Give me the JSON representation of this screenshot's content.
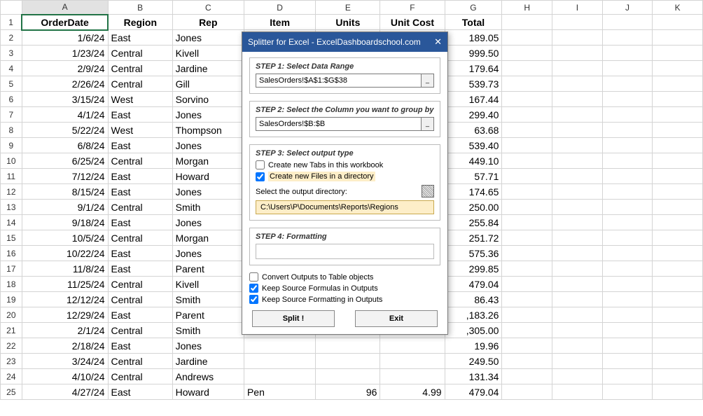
{
  "columns": [
    "",
    "A",
    "B",
    "C",
    "D",
    "E",
    "F",
    "G",
    "H",
    "I",
    "J",
    "K"
  ],
  "headers": [
    "OrderDate",
    "Region",
    "Rep",
    "Item",
    "Units",
    "Unit Cost",
    "Total"
  ],
  "rows": [
    {
      "n": 2,
      "d": "1/6/24",
      "reg": "East",
      "rep": "Jones",
      "t": "189.05"
    },
    {
      "n": 3,
      "d": "1/23/24",
      "reg": "Central",
      "rep": "Kivell",
      "t": "999.50"
    },
    {
      "n": 4,
      "d": "2/9/24",
      "reg": "Central",
      "rep": "Jardine",
      "t": "179.64"
    },
    {
      "n": 5,
      "d": "2/26/24",
      "reg": "Central",
      "rep": "Gill",
      "t": "539.73"
    },
    {
      "n": 6,
      "d": "3/15/24",
      "reg": "West",
      "rep": "Sorvino",
      "t": "167.44"
    },
    {
      "n": 7,
      "d": "4/1/24",
      "reg": "East",
      "rep": "Jones",
      "t": "299.40"
    },
    {
      "n": 8,
      "d": "5/22/24",
      "reg": "West",
      "rep": "Thompson",
      "t": "63.68"
    },
    {
      "n": 9,
      "d": "6/8/24",
      "reg": "East",
      "rep": "Jones",
      "t": "539.40"
    },
    {
      "n": 10,
      "d": "6/25/24",
      "reg": "Central",
      "rep": "Morgan",
      "t": "449.10"
    },
    {
      "n": 11,
      "d": "7/12/24",
      "reg": "East",
      "rep": "Howard",
      "t": "57.71"
    },
    {
      "n": 12,
      "d": "8/15/24",
      "reg": "East",
      "rep": "Jones",
      "t": "174.65"
    },
    {
      "n": 13,
      "d": "9/1/24",
      "reg": "Central",
      "rep": "Smith",
      "t": "250.00"
    },
    {
      "n": 14,
      "d": "9/18/24",
      "reg": "East",
      "rep": "Jones",
      "t": "255.84"
    },
    {
      "n": 15,
      "d": "10/5/24",
      "reg": "Central",
      "rep": "Morgan",
      "t": "251.72"
    },
    {
      "n": 16,
      "d": "10/22/24",
      "reg": "East",
      "rep": "Jones",
      "t": "575.36"
    },
    {
      "n": 17,
      "d": "11/8/24",
      "reg": "East",
      "rep": "Parent",
      "t": "299.85"
    },
    {
      "n": 18,
      "d": "11/25/24",
      "reg": "Central",
      "rep": "Kivell",
      "t": "479.04"
    },
    {
      "n": 19,
      "d": "12/12/24",
      "reg": "Central",
      "rep": "Smith",
      "t": "86.43"
    },
    {
      "n": 20,
      "d": "12/29/24",
      "reg": "East",
      "rep": "Parent",
      "t": ",183.26"
    },
    {
      "n": 21,
      "d": "2/1/24",
      "reg": "Central",
      "rep": "Smith",
      "t": ",305.00"
    },
    {
      "n": 22,
      "d": "2/18/24",
      "reg": "East",
      "rep": "Jones",
      "t": "19.96"
    },
    {
      "n": 23,
      "d": "3/24/24",
      "reg": "Central",
      "rep": "Jardine",
      "t": "249.50"
    },
    {
      "n": 24,
      "d": "4/10/24",
      "reg": "Central",
      "rep": "Andrews",
      "t": "131.34"
    },
    {
      "n": 25,
      "d": "4/27/24",
      "reg": "East",
      "rep": "Howard",
      "t": "479.04",
      "item": "Pen",
      "units": "96",
      "cost": "4.99"
    }
  ],
  "dialog": {
    "title": "Splitter for Excel - ExcelDashboardschool.com",
    "step1": "STEP 1: Select Data Range",
    "range1": "SalesOrders!$A$1:$G$38",
    "step2": "STEP 2: Select the Column you want to group by",
    "range2": "SalesOrders!$B:$B",
    "step3": "STEP 3: Select output type",
    "opt_tabs": "Create new Tabs in this workbook",
    "opt_files": "Create new Files in a directory",
    "dirlabel": "Select the output directory:",
    "dirpath": "C:\\Users\\P\\Documents\\Reports\\Regions",
    "step4": "STEP 4: Formatting",
    "chk_table": "Convert Outputs to Table objects",
    "chk_formulas": "Keep Source Formulas in Outputs",
    "chk_fmt": "Keep Source Formatting in Outputs",
    "btn_split": "Split !",
    "btn_exit": "Exit"
  }
}
